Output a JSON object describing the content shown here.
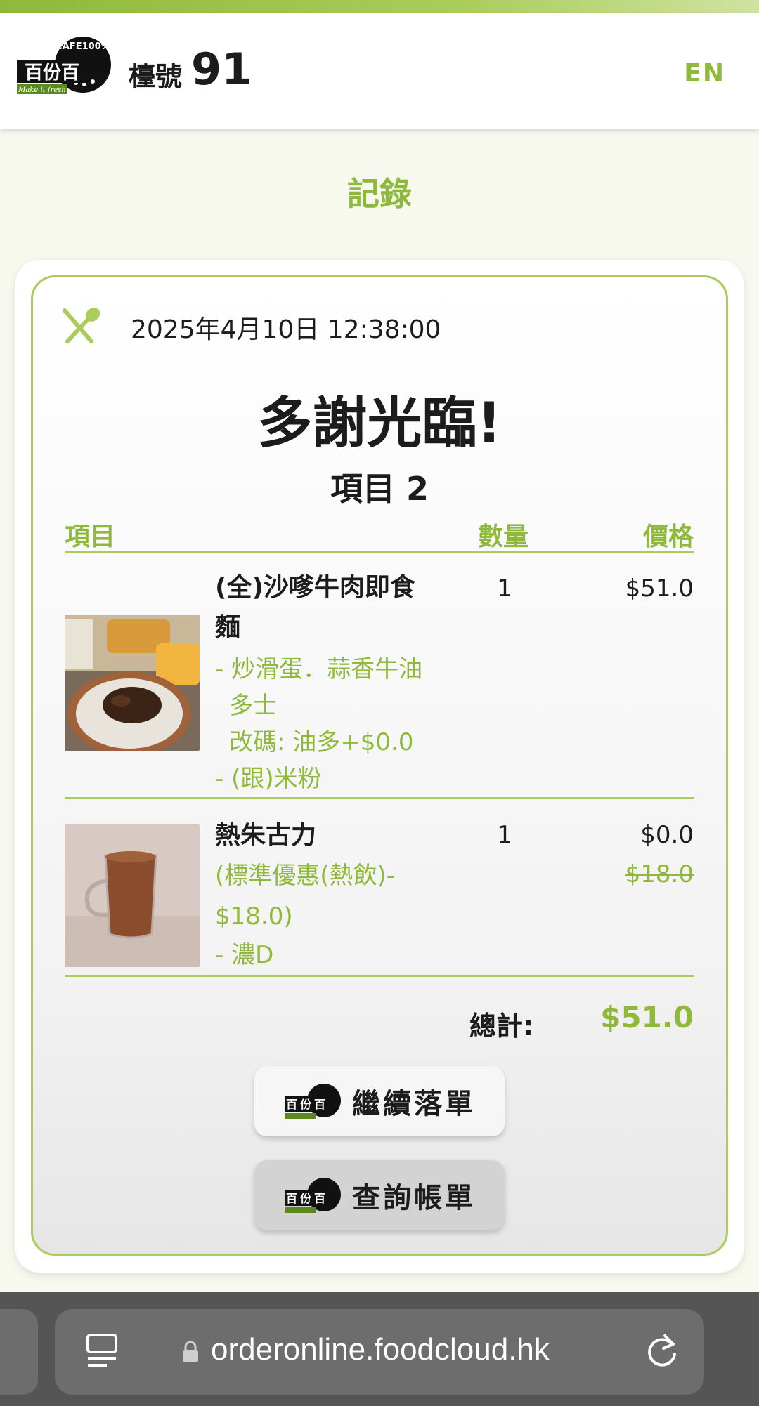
{
  "header": {
    "logo_text": "百份百",
    "logo_arc_text": "CAFE100%",
    "logo_tagline": "Make it fresh",
    "table_label": "檯號",
    "table_number": "91",
    "lang_toggle": "EN"
  },
  "page": {
    "title": "記錄"
  },
  "receipt": {
    "datetime": "2025年4月10日 12:38:00",
    "thanks": "多謝光臨!",
    "items_count": "項目 2",
    "columns": {
      "item": "項目",
      "qty": "數量",
      "price": "價格"
    },
    "items": [
      {
        "name_line1": "(全)沙嗲牛肉即食",
        "name_line2": "麵",
        "options": [
          "- 炒滑蛋．蒜香牛油",
          "  多士",
          "  改碼: 油多+$0.0",
          "- (跟)米粉"
        ],
        "qty": "1",
        "price": "$51.0"
      },
      {
        "name_line1": "熱朱古力",
        "options": [
          "(標準優惠(熱飲)-",
          "$18.0)",
          "- 濃D"
        ],
        "qty": "1",
        "price": "$0.0",
        "original_price": "$18.0"
      }
    ],
    "total_label": "總計:",
    "total_value": "$51.0"
  },
  "actions": {
    "continue_order": "繼續落單",
    "view_bill": "查詢帳單"
  },
  "browser": {
    "url": "orderonline.foodcloud.hk"
  },
  "colors": {
    "accent": "#8fb93a",
    "accent_light": "#a9cc5a",
    "text": "#1c1c1c"
  },
  "icons": [
    "utensils-icon",
    "reader-mode-icon",
    "lock-icon",
    "reload-icon"
  ]
}
